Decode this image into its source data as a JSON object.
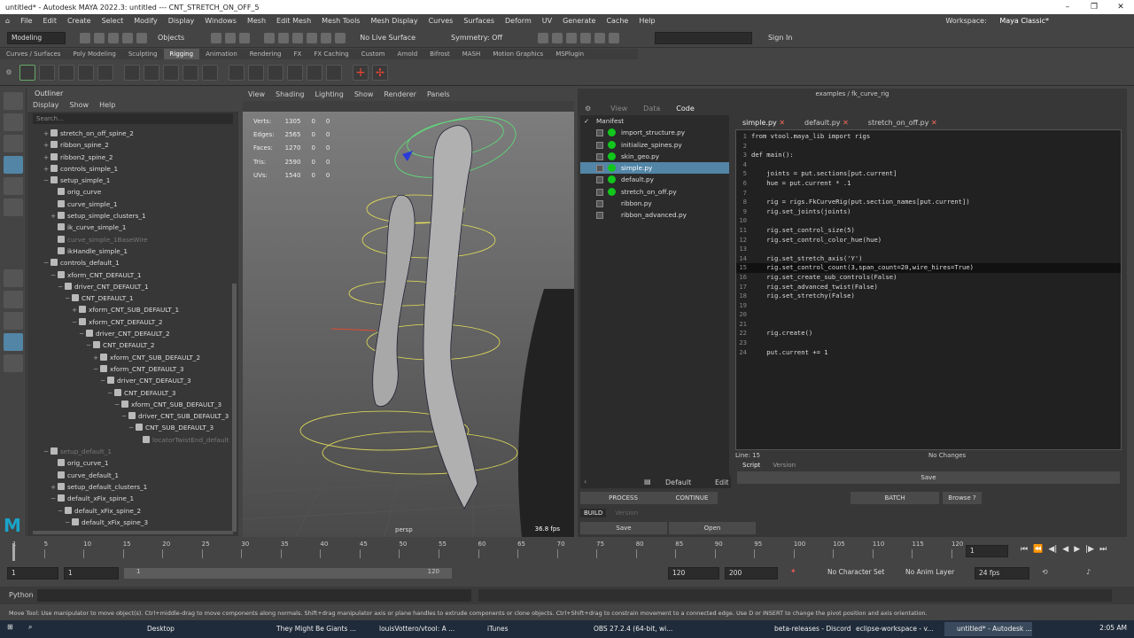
{
  "window": {
    "title": "untitled* - Autodesk MAYA 2022.3: untitled   ---   CNT_STRETCH_ON_OFF_5",
    "controls": [
      "–",
      "❐",
      "✕"
    ]
  },
  "menubar": [
    "File",
    "Edit",
    "Create",
    "Select",
    "Modify",
    "Display",
    "Windows",
    "Mesh",
    "Edit Mesh",
    "Mesh Tools",
    "Mesh Display",
    "Curves",
    "Surfaces",
    "Deform",
    "UV",
    "Generate",
    "Cache",
    "Help"
  ],
  "workspace": {
    "label": "Workspace:",
    "value": "Maya Classic*"
  },
  "status": {
    "mode": "Modeling",
    "objects": "Objects",
    "live": "No Live Surface",
    "symmetry": "Symmetry: Off",
    "signin": "Sign In"
  },
  "shelf_tabs": [
    "Curves / Surfaces",
    "Poly Modeling",
    "Sculpting",
    "Rigging",
    "Animation",
    "Rendering",
    "FX",
    "FX Caching",
    "Custom",
    "Arnold",
    "Bifrost",
    "MASH",
    "Motion Graphics",
    "MSPlugin"
  ],
  "shelf_active": "Rigging",
  "outliner": {
    "title": "Outliner",
    "menu": [
      "Display",
      "Show",
      "Help"
    ],
    "search": "Search...",
    "nodes": [
      {
        "label": "stretch_on_off_spine_2",
        "indent": 2,
        "exp": "+"
      },
      {
        "label": "ribbon_spine_2",
        "indent": 2,
        "exp": "+"
      },
      {
        "label": "ribbon2_spine_2",
        "indent": 2,
        "exp": "+"
      },
      {
        "label": "controls_simple_1",
        "indent": 2,
        "exp": "+"
      },
      {
        "label": "setup_simple_1",
        "indent": 2,
        "exp": "−"
      },
      {
        "label": "orig_curve",
        "indent": 3,
        "exp": ""
      },
      {
        "label": "curve_simple_1",
        "indent": 3,
        "exp": ""
      },
      {
        "label": "setup_simple_clusters_1",
        "indent": 3,
        "exp": "+"
      },
      {
        "label": "ik_curve_simple_1",
        "indent": 3,
        "exp": ""
      },
      {
        "label": "curve_simple_1BaseWire",
        "indent": 3,
        "exp": "",
        "dim": true
      },
      {
        "label": "ikHandle_simple_1",
        "indent": 3,
        "exp": ""
      },
      {
        "label": "controls_default_1",
        "indent": 2,
        "exp": "−"
      },
      {
        "label": "xform_CNT_DEFAULT_1",
        "indent": 3,
        "exp": "−"
      },
      {
        "label": "driver_CNT_DEFAULT_1",
        "indent": 4,
        "exp": "−"
      },
      {
        "label": "CNT_DEFAULT_1",
        "indent": 5,
        "exp": "−"
      },
      {
        "label": "xform_CNT_SUB_DEFAULT_1",
        "indent": 6,
        "exp": "+"
      },
      {
        "label": "xform_CNT_DEFAULT_2",
        "indent": 6,
        "exp": "−"
      },
      {
        "label": "driver_CNT_DEFAULT_2",
        "indent": 7,
        "exp": "−"
      },
      {
        "label": "CNT_DEFAULT_2",
        "indent": 8,
        "exp": "−"
      },
      {
        "label": "xform_CNT_SUB_DEFAULT_2",
        "indent": 9,
        "exp": "+"
      },
      {
        "label": "xform_CNT_DEFAULT_3",
        "indent": 9,
        "exp": "−"
      },
      {
        "label": "driver_CNT_DEFAULT_3",
        "indent": 10,
        "exp": "−"
      },
      {
        "label": "CNT_DEFAULT_3",
        "indent": 11,
        "exp": "−"
      },
      {
        "label": "xform_CNT_SUB_DEFAULT_3",
        "indent": 12,
        "exp": "−"
      },
      {
        "label": "driver_CNT_SUB_DEFAULT_3",
        "indent": 13,
        "exp": "−"
      },
      {
        "label": "CNT_SUB_DEFAULT_3",
        "indent": 14,
        "exp": "−"
      },
      {
        "label": "locatorTwistEnd_default",
        "indent": 15,
        "exp": "",
        "dim": true
      },
      {
        "label": "setup_default_1",
        "indent": 2,
        "exp": "−",
        "dim": true
      },
      {
        "label": "orig_curve_1",
        "indent": 3,
        "exp": ""
      },
      {
        "label": "curve_default_1",
        "indent": 3,
        "exp": ""
      },
      {
        "label": "setup_default_clusters_1",
        "indent": 3,
        "exp": "+"
      },
      {
        "label": "default_xFix_spine_1",
        "indent": 3,
        "exp": "−"
      },
      {
        "label": "default_xFix_spine_2",
        "indent": 4,
        "exp": "−"
      },
      {
        "label": "default_xFix_spine_3",
        "indent": 5,
        "exp": "−"
      }
    ]
  },
  "viewport": {
    "menu": [
      "View",
      "Shading",
      "Lighting",
      "Show",
      "Renderer",
      "Panels"
    ],
    "hud": [
      [
        "Verts:",
        "1305",
        "0",
        "0"
      ],
      [
        "Edges:",
        "2565",
        "0",
        "0"
      ],
      [
        "Faces:",
        "1270",
        "0",
        "0"
      ],
      [
        "Tris:",
        "2590",
        "0",
        "0"
      ],
      [
        "UVs:",
        "1540",
        "0",
        "0"
      ]
    ],
    "camera": "persp",
    "fps": "36.8 fps"
  },
  "rig": {
    "path": "examples  /  fk_curve_rig",
    "tabs": [
      "View",
      "Data",
      "Code"
    ],
    "active_tab": "Code",
    "manifest_title": "Manifest",
    "manifest": [
      {
        "label": "import_structure.py",
        "dot": true,
        "sel": false
      },
      {
        "label": "initialize_spines.py",
        "dot": true,
        "sel": false
      },
      {
        "label": "skin_geo.py",
        "dot": true,
        "sel": false
      },
      {
        "label": "simple.py",
        "dot": true,
        "sel": true
      },
      {
        "label": "default.py",
        "dot": true,
        "sel": false
      },
      {
        "label": "stretch_on_off.py",
        "dot": true,
        "sel": false
      },
      {
        "label": "ribbon.py",
        "dot": false,
        "sel": false
      },
      {
        "label": "ribbon_advanced.py",
        "dot": false,
        "sel": false
      }
    ],
    "file_tabs": [
      "simple.py",
      "default.py",
      "stretch_on_off.py"
    ],
    "code": [
      [
        "1",
        "from vtool.maya_lib import rigs"
      ],
      [
        "2",
        ""
      ],
      [
        "3",
        "def main():"
      ],
      [
        "4",
        ""
      ],
      [
        "5",
        "    joints = put.sections[put.current]"
      ],
      [
        "6",
        "    hue = put.current * .1"
      ],
      [
        "7",
        ""
      ],
      [
        "8",
        "    rig = rigs.FkCurveRig(put.section_names[put.current])"
      ],
      [
        "9",
        "    rig.set_joints(joints)"
      ],
      [
        "10",
        ""
      ],
      [
        "11",
        "    rig.set_control_size(5)"
      ],
      [
        "12",
        "    rig.set_control_color_hue(hue)"
      ],
      [
        "13",
        ""
      ],
      [
        "14",
        "    rig.set_stretch_axis('Y')"
      ],
      [
        "15",
        "    rig.set_control_count(3,span_count=20,wire_hires=True)"
      ],
      [
        "16",
        "    rig.set_create_sub_controls(False)"
      ],
      [
        "17",
        "    rig.set_advanced_twist(False)"
      ],
      [
        "18",
        "    rig.set_stretchy(False)"
      ],
      [
        "19",
        ""
      ],
      [
        "20",
        ""
      ],
      [
        "21",
        ""
      ],
      [
        "22",
        "    rig.create()"
      ],
      [
        "23",
        ""
      ],
      [
        "24",
        "    put.current += 1"
      ]
    ],
    "line_info": "Line: 15",
    "changes": "No Changes",
    "script_tabs": [
      "Script",
      "Version"
    ],
    "save": "Save",
    "default_label": "Default",
    "edit": "Edit",
    "process": "PROCESS",
    "continue": "CONTINUE",
    "batch": "BATCH",
    "browse": "Browse",
    "help_q": "?",
    "build": "BUILD",
    "version": "Version",
    "save2": "Save",
    "open": "Open"
  },
  "timeline": {
    "ticks": [
      "1",
      "5",
      "10",
      "15",
      "20",
      "25",
      "30",
      "35",
      "40",
      "45",
      "50",
      "55",
      "60",
      "65",
      "70",
      "75",
      "80",
      "85",
      "90",
      "95",
      "100",
      "105",
      "110",
      "115",
      "120"
    ],
    "current": "1"
  },
  "range": {
    "start": "1",
    "start2": "1",
    "slider_end": "120",
    "end": "120",
    "end2": "200",
    "char_set": "No Character Set",
    "anim_layer": "No Anim Layer",
    "fps": "24 fps"
  },
  "cmd": {
    "lang": "Python"
  },
  "help": "Move Tool: Use manipulator to move object(s). Ctrl+middle-drag to move components along normals. Shift+drag manipulator axis or plane handles to extrude components or clone objects. Ctrl+Shift+drag to constrain movement to a connected edge. Use D or INSERT to change the pivot position and axis orientation.",
  "taskbar": {
    "items": [
      "Desktop",
      "They Might Be Giants ...",
      "louisVottero/vtool: A ...",
      "iTunes",
      "OBS 27.2.4 (64-bit, wi...",
      "beta-releases - Discord",
      "eclipse-workspace - v...",
      "untitled* - Autodesk ..."
    ],
    "clock": "2:05 AM"
  },
  "colors": {
    "accent": "#5285a6",
    "ok": "#11c71c"
  }
}
